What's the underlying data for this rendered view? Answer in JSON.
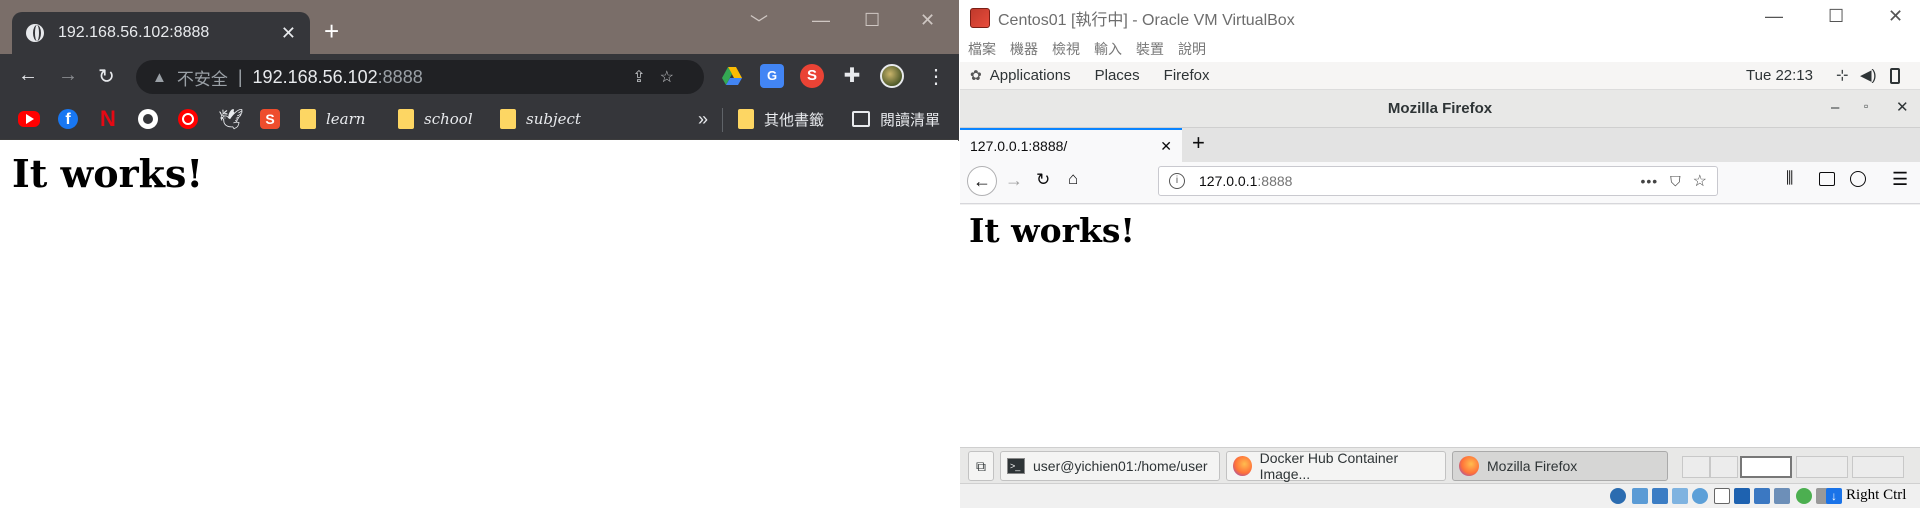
{
  "chrome": {
    "tab_title": "192.168.56.102:8888",
    "tab_close": "✕",
    "new_tab": "+",
    "win_minimize": "﹀",
    "win_restore": "—",
    "win_maximize": "☐",
    "win_close": "✕",
    "nav": {
      "back": "←",
      "forward": "→",
      "reload": "↻"
    },
    "omnibox": {
      "warn_icon": "▲",
      "insecure_label": "不安全",
      "separator": "|",
      "host": "192.168.56.102",
      "port": ":8888",
      "share_icon": "⇪",
      "star_icon": "☆"
    },
    "extensions": [
      {
        "name": "google-drive",
        "color": "#34a853"
      },
      {
        "name": "google-translate",
        "color": "#4285f4"
      },
      {
        "name": "s-extension",
        "color": "#ea4335",
        "text": "S"
      },
      {
        "name": "puzzle",
        "color": "#e8eaed"
      },
      {
        "name": "profile-avatar",
        "color": "#6b7b3a"
      }
    ],
    "menu_icon": "⋮",
    "bookmarks": {
      "items": [
        {
          "name": "youtube",
          "color": "#ff0000"
        },
        {
          "name": "facebook",
          "color": "#1877f2"
        },
        {
          "name": "netflix",
          "color": "#e50914"
        },
        {
          "name": "github",
          "color": "#ffffff"
        },
        {
          "name": "youtube-music",
          "color": "#ff0000"
        },
        {
          "name": "bird",
          "color": "#e8eaed"
        },
        {
          "name": "shopee",
          "color": "#ee4d2d"
        }
      ],
      "folders": [
        "learn",
        "school",
        "subject"
      ],
      "overflow": "»",
      "other": "其他書籤",
      "reading_list": "閱讀清單"
    },
    "page_heading": "It works!"
  },
  "vbox": {
    "title": "Centos01 [執行中] - Oracle VM VirtualBox",
    "menu": [
      "檔案",
      "機器",
      "檢視",
      "輸入",
      "裝置",
      "說明"
    ],
    "gnome": {
      "applications": "Applications",
      "places": "Places",
      "firefox": "Firefox",
      "clock": "Tue 22:13"
    },
    "firefox": {
      "window_title": "Mozilla Firefox",
      "tab_title": "127.0.0.1:8888/",
      "tab_close": "✕",
      "new_tab": "+",
      "url_host": "127.0.0.1",
      "url_port": ":8888",
      "url_actions": "•••",
      "page_heading": "It works!"
    },
    "taskbar": [
      {
        "label": "user@yichien01:/home/user"
      },
      {
        "label": "Docker Hub Container Image..."
      },
      {
        "label": "Mozilla Firefox"
      }
    ],
    "status_right": "Right Ctrl"
  }
}
